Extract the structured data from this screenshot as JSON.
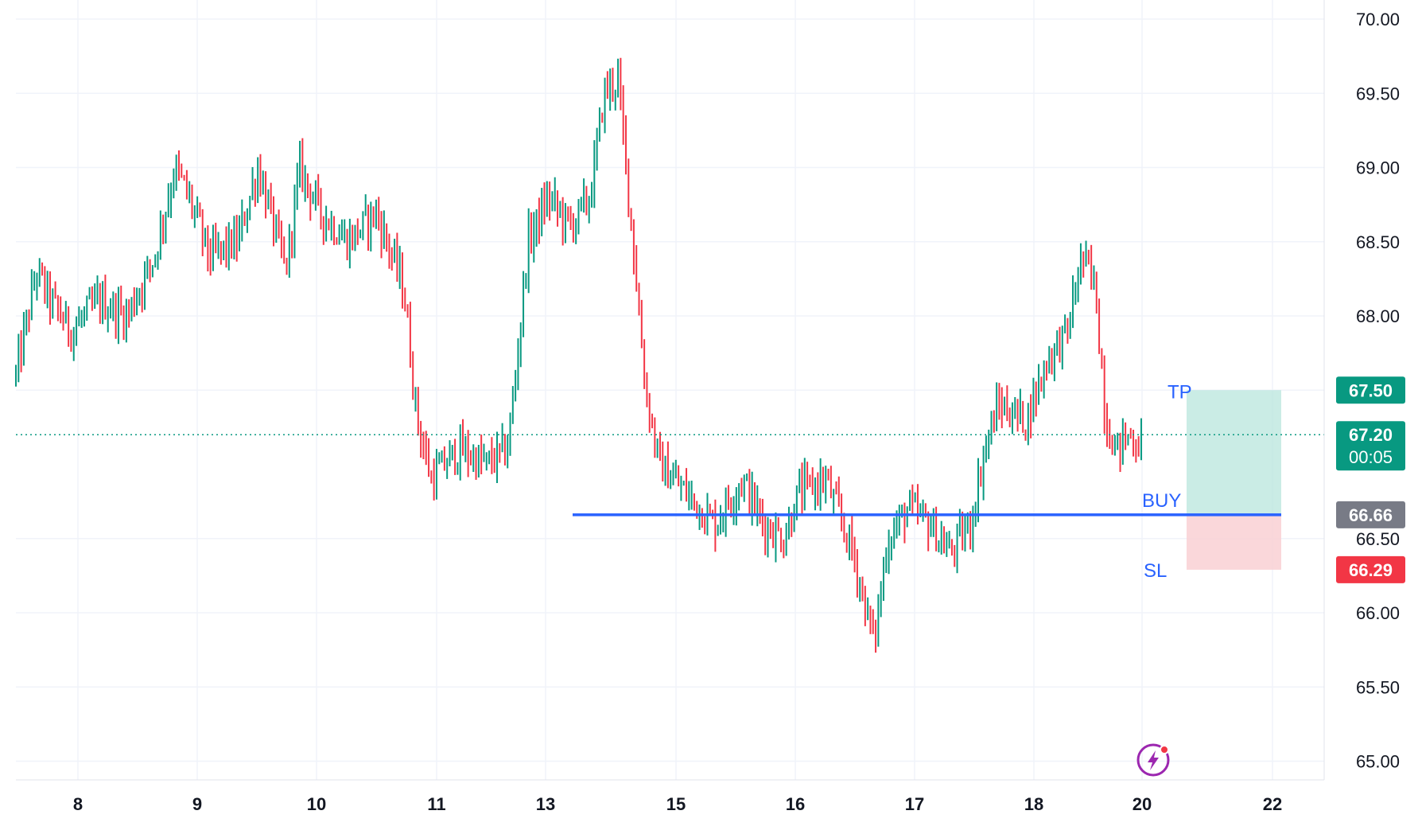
{
  "chart_data": {
    "type": "ohlc",
    "instrument_axis": "price",
    "x_ticks": [
      "8",
      "9",
      "10",
      "11",
      "13",
      "15",
      "16",
      "17",
      "18",
      "20",
      "22"
    ],
    "y_ticks": [
      "70.00",
      "69.50",
      "69.00",
      "68.50",
      "68.00",
      "67.50",
      "66.50",
      "66.00",
      "65.50",
      "65.00"
    ],
    "ylim": [
      64.9,
      70.1
    ],
    "grid": true,
    "price_path": [
      {
        "t": 0,
        "p": 67.6
      },
      {
        "t": 0.3,
        "p": 68.3
      },
      {
        "t": 0.5,
        "p": 68.1
      },
      {
        "t": 0.8,
        "p": 67.9
      },
      {
        "t": 1.2,
        "p": 68.1
      },
      {
        "t": 1.6,
        "p": 68.0
      },
      {
        "t": 2.0,
        "p": 68.4
      },
      {
        "t": 2.3,
        "p": 69.0
      },
      {
        "t": 2.5,
        "p": 68.8
      },
      {
        "t": 2.8,
        "p": 68.4
      },
      {
        "t": 3.2,
        "p": 68.5
      },
      {
        "t": 3.5,
        "p": 69.0
      },
      {
        "t": 3.9,
        "p": 68.3
      },
      {
        "t": 4.1,
        "p": 69.0
      },
      {
        "t": 4.4,
        "p": 68.7
      },
      {
        "t": 4.8,
        "p": 68.5
      },
      {
        "t": 5.2,
        "p": 68.7
      },
      {
        "t": 5.6,
        "p": 68.2
      },
      {
        "t": 5.8,
        "p": 67.3
      },
      {
        "t": 6.0,
        "p": 66.9
      },
      {
        "t": 6.4,
        "p": 67.1
      },
      {
        "t": 6.8,
        "p": 67.0
      },
      {
        "t": 7.1,
        "p": 67.1
      },
      {
        "t": 7.2,
        "p": 67.5
      },
      {
        "t": 7.4,
        "p": 68.5
      },
      {
        "t": 7.7,
        "p": 68.8
      },
      {
        "t": 8.0,
        "p": 68.6
      },
      {
        "t": 8.3,
        "p": 68.8
      },
      {
        "t": 8.5,
        "p": 69.5
      },
      {
        "t": 8.7,
        "p": 69.6
      },
      {
        "t": 8.9,
        "p": 68.6
      },
      {
        "t": 9.1,
        "p": 67.5
      },
      {
        "t": 9.3,
        "p": 67.0
      },
      {
        "t": 9.7,
        "p": 66.8
      },
      {
        "t": 10.1,
        "p": 66.6
      },
      {
        "t": 10.5,
        "p": 66.9
      },
      {
        "t": 10.8,
        "p": 66.6
      },
      {
        "t": 11.1,
        "p": 66.5
      },
      {
        "t": 11.3,
        "p": 66.8
      },
      {
        "t": 11.7,
        "p": 66.9
      },
      {
        "t": 12.1,
        "p": 66.4
      },
      {
        "t": 12.4,
        "p": 65.8
      },
      {
        "t": 12.6,
        "p": 66.5
      },
      {
        "t": 12.9,
        "p": 66.7
      },
      {
        "t": 13.2,
        "p": 66.6
      },
      {
        "t": 13.5,
        "p": 66.4
      },
      {
        "t": 13.8,
        "p": 66.6
      },
      {
        "t": 14.0,
        "p": 67.1
      },
      {
        "t": 14.2,
        "p": 67.4
      },
      {
        "t": 14.6,
        "p": 67.3
      },
      {
        "t": 14.9,
        "p": 67.7
      },
      {
        "t": 15.2,
        "p": 67.9
      },
      {
        "t": 15.4,
        "p": 68.4
      },
      {
        "t": 15.6,
        "p": 68.2
      },
      {
        "t": 15.75,
        "p": 67.3
      },
      {
        "t": 15.9,
        "p": 67.1
      },
      {
        "t": 16.1,
        "p": 67.2
      },
      {
        "t": 16.3,
        "p": 67.1
      }
    ]
  },
  "position": {
    "entry_label": "BUY",
    "take_profit_label": "TP",
    "stop_loss_label": "SL",
    "entry_price": 66.66,
    "take_profit_price": 67.5,
    "stop_loss_price": 66.29
  },
  "price_scale": {
    "take_profit_badge": "67.50",
    "last_price_badge": "67.20",
    "countdown": "00:05",
    "entry_badge": "66.66",
    "stop_loss_badge": "66.29",
    "last_price": 67.2
  },
  "colors": {
    "up": "#089981",
    "down": "#f23645",
    "entry_line": "#2962ff",
    "profit_zone": "#b8e6dc",
    "loss_zone": "#f9d0d3",
    "entry_badge": "#787b86",
    "grid": "#f0f3fa",
    "logo": "#9c27b0"
  },
  "icons": {
    "logo": "lightning-bolt-icon"
  }
}
